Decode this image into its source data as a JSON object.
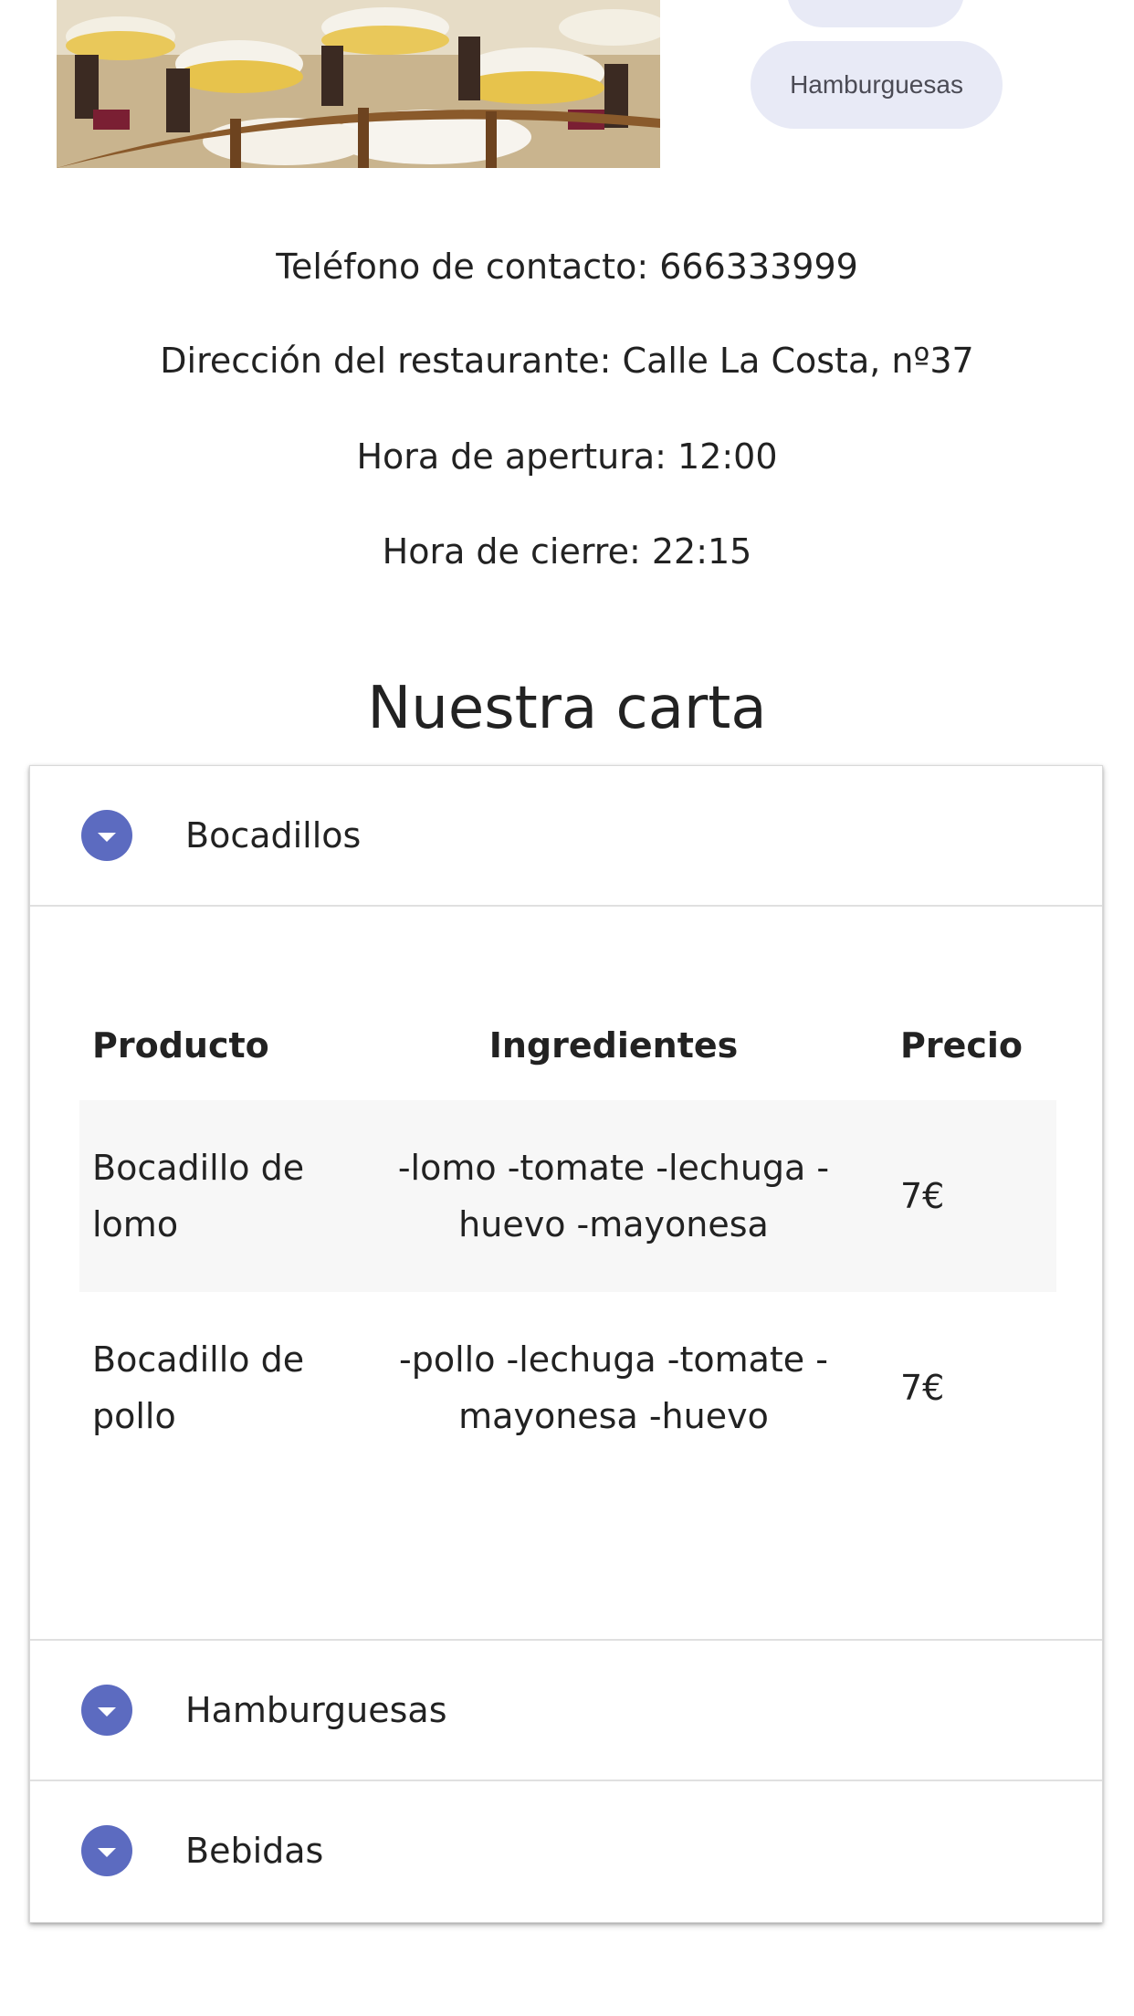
{
  "chips": {
    "hamburguesas": "Hamburguesas"
  },
  "info": {
    "phone": "Teléfono de contacto: 666333999",
    "address": "Dirección del restaurante: Calle La Costa, nº37",
    "opening": "Hora de apertura: 12:00",
    "closing": "Hora de cierre: 22:15"
  },
  "menu": {
    "title": "Nuestra carta",
    "sections": [
      {
        "label": "Bocadillos"
      },
      {
        "label": "Hamburguesas"
      },
      {
        "label": "Bebidas"
      }
    ],
    "table": {
      "headers": {
        "product": "Producto",
        "ingredients": "Ingredientes",
        "price": "Precio"
      },
      "rows": [
        {
          "product": "Bocadillo de lomo",
          "ingredients": "-lomo -tomate -lechuga -huevo -mayonesa",
          "price": "7€"
        },
        {
          "product": "Bocadillo de pollo",
          "ingredients": "-pollo -lechuga -tomate -mayonesa -huevo",
          "price": "7€"
        }
      ]
    }
  },
  "colors": {
    "accent": "#5c6bc0",
    "chip_bg": "#e8eaf6",
    "row_shade": "#f7f7f7"
  },
  "icons": {
    "toggle": "chevron-down-icon"
  }
}
